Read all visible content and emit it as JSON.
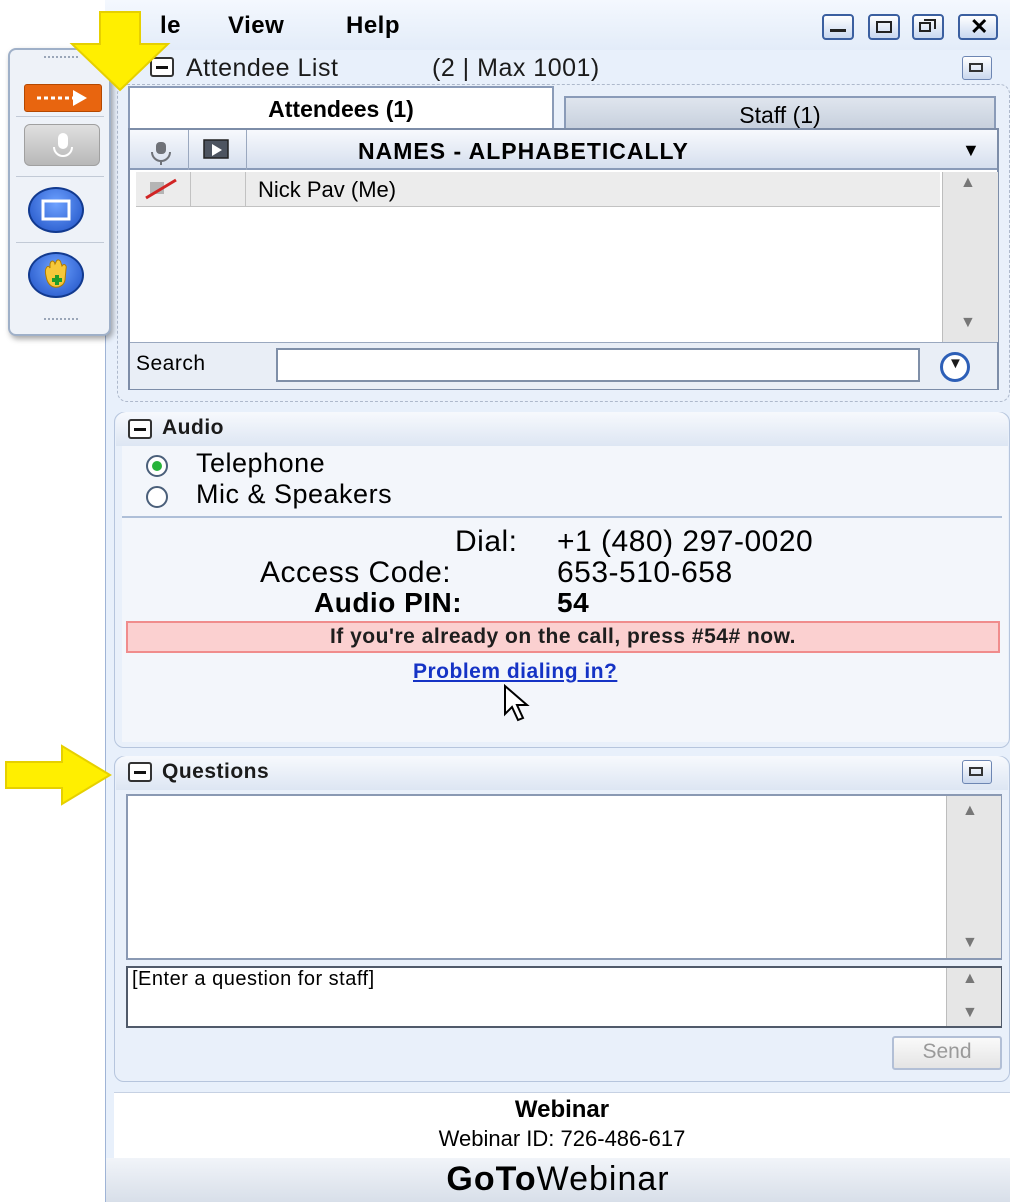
{
  "menu": {
    "file": "le",
    "view": "View",
    "help": "Help"
  },
  "attendee_panel": {
    "title": "Attendee List",
    "count": "(2 | Max 1001)",
    "tabs": [
      {
        "label": "Attendees (1)"
      },
      {
        "label": "Staff (1)"
      }
    ],
    "column_header": "NAMES - ALPHABETICALLY",
    "rows": [
      {
        "name": "Nick Pav (Me)"
      }
    ],
    "search_label": "Search",
    "search_value": ""
  },
  "audio_panel": {
    "title": "Audio",
    "options": [
      {
        "label": "Telephone",
        "selected": true
      },
      {
        "label": "Mic & Speakers",
        "selected": false
      }
    ],
    "dial_label": "Dial:",
    "dial_value": "+1 (480) 297-0020",
    "access_label": "Access Code:",
    "access_value": "653-510-658",
    "pin_label": "Audio PIN:",
    "pin_value": "54",
    "notice": "If you're already on the call, press #54# now.",
    "problem_link": "Problem dialing in?"
  },
  "questions_panel": {
    "title": "Questions",
    "input_placeholder": "[Enter a question for staff]",
    "send_label": "Send"
  },
  "footer": {
    "webinar_title": "Webinar",
    "webinar_id": "Webinar ID: 726-486-617",
    "brand_goto": "GoTo",
    "brand_webinar": "Webinar"
  },
  "colors": {
    "window_bg": "#e8f0fb",
    "accent_blue": "#2f62c2",
    "notice_bg": "#fbd0d0",
    "annotation_arrow": "#ffef00"
  }
}
